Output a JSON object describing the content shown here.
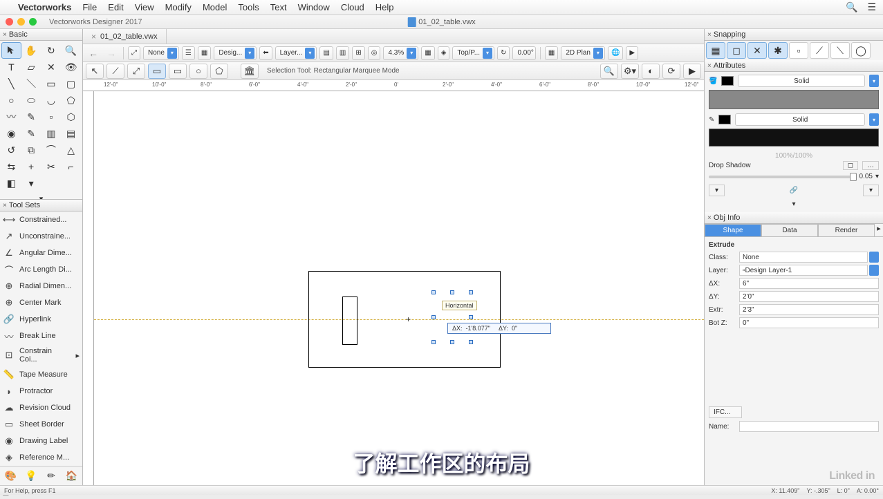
{
  "menubar": {
    "app": "Vectorworks",
    "items": [
      "File",
      "Edit",
      "View",
      "Modify",
      "Model",
      "Tools",
      "Text",
      "Window",
      "Cloud",
      "Help"
    ]
  },
  "window": {
    "title_left": "Vectorworks Designer 2017",
    "title_center": "01_02_table.vwx"
  },
  "doc_tab": {
    "name": "01_02_table.vwx"
  },
  "toolbar": {
    "class_sel": "None",
    "layer_sel": "Desig...",
    "layer2_sel": "Layer...",
    "zoom": "4.3%",
    "view1": "Top/P...",
    "angle": "0.00°",
    "view2": "2D Plan"
  },
  "modebar": {
    "label": "Selection Tool: Rectangular Marquee Mode"
  },
  "ruler_ticks": [
    "12'-0\"",
    "10'-0\"",
    "8'-0\"",
    "6'-0\"",
    "4'-0\"",
    "2'-0\"",
    "0'",
    "2'-0\"",
    "4'-0\"",
    "6'-0\"",
    "8'-0\"",
    "10'-0\"",
    "12'-0\""
  ],
  "canvas": {
    "hint": "Horizontal",
    "dx_label": "ΔX:",
    "dx_val": "-1'8.077\"",
    "dy_label": "ΔY:",
    "dy_val": "0\""
  },
  "basic_title": "Basic",
  "toolsets": {
    "title": "Tool Sets",
    "items": [
      "Constrained...",
      "Unconstraine...",
      "Angular Dime...",
      "Arc Length Di...",
      "Radial Dimen...",
      "Center Mark",
      "Hyperlink",
      "Break Line",
      "Constrain Coi...",
      "Tape Measure",
      "Protractor",
      "Revision Cloud",
      "Sheet Border",
      "Drawing Label",
      "Reference M..."
    ]
  },
  "snapping": {
    "title": "Snapping"
  },
  "attributes": {
    "title": "Attributes",
    "fill_type": "Solid",
    "line_type": "Solid",
    "pct": "100%/100%",
    "drop_shadow": "Drop Shadow",
    "opacity": "0.05"
  },
  "objinfo": {
    "title": "Obj Info",
    "tabs": [
      "Shape",
      "Data",
      "Render"
    ],
    "heading": "Extrude",
    "class_lab": "Class:",
    "class_val": "None",
    "layer_lab": "Layer:",
    "layer_val": "Design Layer-1",
    "dx_lab": "ΔX:",
    "dx_val": "6\"",
    "dy_lab": "ΔY:",
    "dy_val": "2'0\"",
    "extr_lab": "Extr:",
    "extr_val": "2'3\"",
    "botz_lab": "Bot Z:",
    "botz_val": "0\"",
    "ifc": "IFC...",
    "name_lab": "Name:"
  },
  "status": {
    "help": "For Help, press F1",
    "x": "X: 11.409\"",
    "y": "Y: -.305\"",
    "l": "L: 0\"",
    "a": "A: 0.00°"
  },
  "subtitle": "了解工作区的布局",
  "linkedin": "Linked in"
}
